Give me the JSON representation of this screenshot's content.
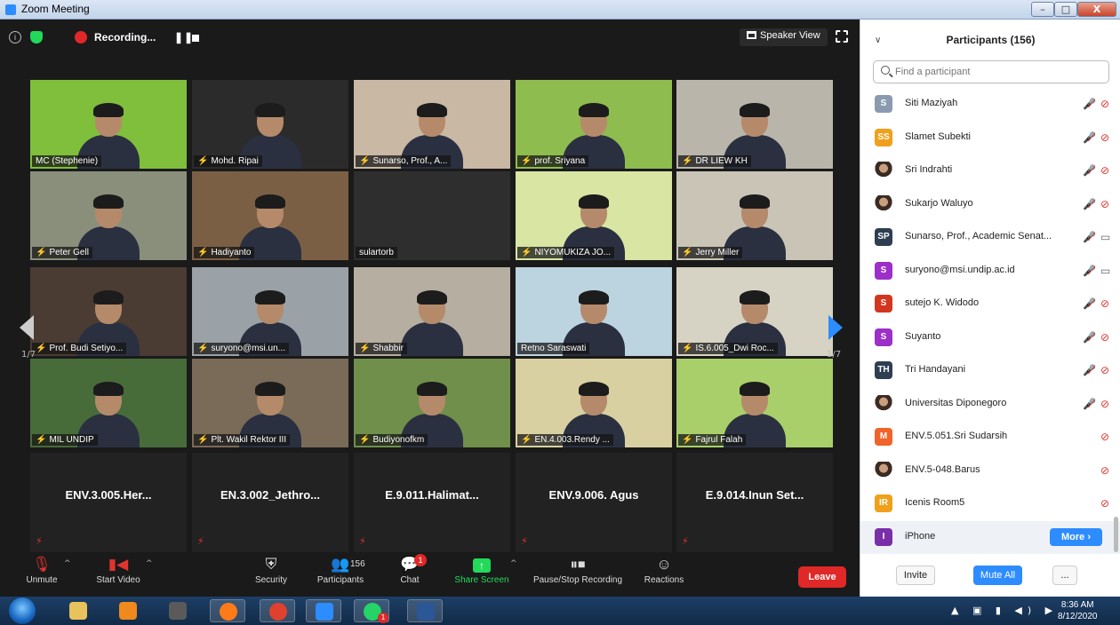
{
  "window": {
    "title": "Zoom Meeting",
    "min": "–",
    "max": "□",
    "close": "X"
  },
  "topbar": {
    "info_icon": "info-icon",
    "recording_label": "Recording...",
    "pause_glyph": "❚❚",
    "view_label": "Speaker View"
  },
  "grid": {
    "page_left": "1/7",
    "page_right": "1/7",
    "tiles": [
      {
        "name": "MC (Stephenie)",
        "muted": false,
        "kind": "video",
        "active": true,
        "bg": "#7fbf3c"
      },
      {
        "name": "Mohd. Ripai",
        "muted": true,
        "kind": "video",
        "bg": "#2b2b2b"
      },
      {
        "name": "Sunarso, Prof., A...",
        "muted": true,
        "kind": "video",
        "bg": "#c9b8a4"
      },
      {
        "name": "prof. Sriyana",
        "muted": true,
        "kind": "video",
        "bg": "#8fbc4e"
      },
      {
        "name": "DR LIEW KH",
        "muted": true,
        "kind": "video",
        "bg": "#b9b5ab"
      },
      {
        "name": "Peter Gell",
        "muted": true,
        "kind": "video",
        "bg": "#8a8f7c"
      },
      {
        "name": "Hadiyanto",
        "muted": true,
        "kind": "video",
        "bg": "#7b5f45"
      },
      {
        "name": "sulartorb",
        "muted": false,
        "kind": "blank",
        "bg": "#2e2e2e"
      },
      {
        "name": "NIYOMUKIZA JO...",
        "muted": true,
        "kind": "video",
        "bg": "#d8e5a3"
      },
      {
        "name": "Jerry Miller",
        "muted": true,
        "kind": "video",
        "bg": "#c9c4b6"
      },
      {
        "name": "Prof. Budi Setiyo...",
        "muted": true,
        "kind": "video",
        "bg": "#4a3b33"
      },
      {
        "name": "suryono@msi.un...",
        "muted": true,
        "kind": "video",
        "bg": "#9aa2a7"
      },
      {
        "name": "Shabbir",
        "muted": true,
        "kind": "video",
        "bg": "#b6aea0"
      },
      {
        "name": "Retno Saraswati",
        "muted": false,
        "kind": "video",
        "bg": "#bcd3e0"
      },
      {
        "name": "IS.6.005_Dwi Roc...",
        "muted": true,
        "kind": "video",
        "bg": "#d7d3c4"
      },
      {
        "name": "MIL UNDIP",
        "muted": true,
        "kind": "video",
        "bg": "#486b3a"
      },
      {
        "name": "Plt. Wakil Rektor III",
        "muted": true,
        "kind": "video",
        "bg": "#7a6a58"
      },
      {
        "name": "Budiyonofkm",
        "muted": true,
        "kind": "video",
        "bg": "#6f8f4a"
      },
      {
        "name": "EN.4.003.Rendy ...",
        "muted": true,
        "kind": "video",
        "bg": "#d8d0a0"
      },
      {
        "name": "Fajrul Falah",
        "muted": true,
        "kind": "video",
        "bg": "#a9cf6a"
      },
      {
        "name": "ENV.3.005.Her...",
        "muted": true,
        "kind": "name"
      },
      {
        "name": "EN.3.002_Jethro...",
        "muted": true,
        "kind": "name"
      },
      {
        "name": "E.9.011.Halimat...",
        "muted": true,
        "kind": "name"
      },
      {
        "name": "ENV.9.006. Agus",
        "muted": true,
        "kind": "name"
      },
      {
        "name": "E.9.014.Inun Set...",
        "muted": true,
        "kind": "name"
      }
    ]
  },
  "toolbar": {
    "unmute": "Unmute",
    "start_video": "Start Video",
    "security": "Security",
    "participants": "Participants",
    "participants_count": "156",
    "chat": "Chat",
    "chat_badge": "1",
    "share_screen": "Share Screen",
    "pause_recording": "Pause/Stop Recording",
    "reactions": "Reactions",
    "leave": "Leave"
  },
  "panel": {
    "title": "Participants (156)",
    "search_placeholder": "Find a participant",
    "participants": [
      {
        "initials": "S",
        "color": "#8a9bb0",
        "name": "Siti Maziyah",
        "mic_muted": true,
        "video_off": true
      },
      {
        "initials": "SS",
        "color": "#f0a01a",
        "name": "Slamet Subekti",
        "mic_muted": true,
        "video_off": true
      },
      {
        "initials": "",
        "color": "photo",
        "name": "Sri Indrahti",
        "mic_muted": true,
        "video_off": true
      },
      {
        "initials": "",
        "color": "photo",
        "name": "Sukarjo Waluyo",
        "mic_muted": true,
        "video_off": true
      },
      {
        "initials": "SP",
        "color": "#2f3f52",
        "name": "Sunarso, Prof., Academic Senat...",
        "mic_muted": true,
        "video_off": false
      },
      {
        "initials": "S",
        "color": "#9b2fc8",
        "name": "suryono@msi.undip.ac.id",
        "mic_muted": true,
        "video_off": false
      },
      {
        "initials": "S",
        "color": "#d2361f",
        "name": "sutejo K. Widodo",
        "mic_muted": true,
        "video_off": true
      },
      {
        "initials": "S",
        "color": "#9b2fc8",
        "name": "Suyanto",
        "mic_muted": true,
        "video_off": true
      },
      {
        "initials": "TH",
        "color": "#2f3f52",
        "name": "Tri Handayani",
        "mic_muted": true,
        "video_off": true
      },
      {
        "initials": "",
        "color": "photo",
        "name": "Universitas Diponegoro",
        "mic_muted": true,
        "video_off": true
      },
      {
        "initials": "M",
        "color": "#f0642a",
        "name": "ENV.5.051.Sri Sudarsih",
        "mic_muted": false,
        "video_off": true
      },
      {
        "initials": "",
        "color": "photo",
        "name": "ENV.5-048.Barus",
        "mic_muted": false,
        "video_off": true
      },
      {
        "initials": "IR",
        "color": "#f0a01a",
        "name": "Icenis Room5",
        "mic_muted": false,
        "video_off": true
      },
      {
        "initials": "I",
        "color": "#7a2fa8",
        "name": "iPhone",
        "mic_muted": false,
        "video_off": false,
        "highlight": true
      }
    ],
    "more_label": "More ›",
    "invite": "Invite",
    "mute_all": "Mute All",
    "dots": "..."
  },
  "taskbar": {
    "time": "8:36 AM",
    "date": "8/12/2020",
    "whatsapp_badge": "1",
    "apps": [
      {
        "name": "explorer",
        "color": "#e8c25a"
      },
      {
        "name": "vlc",
        "color": "#f08a1c"
      },
      {
        "name": "tool",
        "color": "#5a5a5a"
      },
      {
        "name": "firefox",
        "color": "#ff7b1a"
      },
      {
        "name": "chrome",
        "color": "#e0412e"
      },
      {
        "name": "zoom",
        "color": "#2d8cff"
      },
      {
        "name": "whatsapp",
        "color": "#25d366"
      },
      {
        "name": "word",
        "color": "#2b5797"
      }
    ]
  }
}
